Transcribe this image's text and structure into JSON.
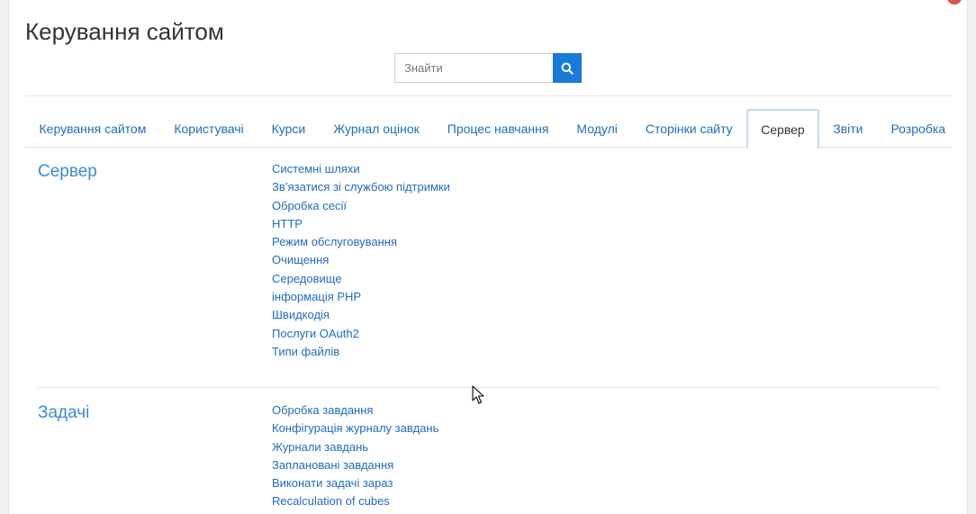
{
  "header": {
    "title": "Керування сайтом"
  },
  "search": {
    "placeholder": "Знайти",
    "icon": "search-icon",
    "button_color": "#1a7ad9"
  },
  "tabs": [
    {
      "label": "Керування сайтом",
      "active": false
    },
    {
      "label": "Користувачі",
      "active": false
    },
    {
      "label": "Курси",
      "active": false
    },
    {
      "label": "Журнал оцінок",
      "active": false
    },
    {
      "label": "Процес навчання",
      "active": false
    },
    {
      "label": "Модулі",
      "active": false
    },
    {
      "label": "Сторінки сайту",
      "active": false
    },
    {
      "label": "Сервер",
      "active": true
    },
    {
      "label": "Звіти",
      "active": false
    },
    {
      "label": "Розробка",
      "active": false
    }
  ],
  "sections": [
    {
      "title": "Сервер",
      "links": [
        "Системні шляхи",
        "Зв’язатися зі службою підтримки",
        "Обробка сесії",
        "HTTP",
        "Режим обслуговування",
        "Очищення",
        "Середовище",
        "інформація PHP",
        "Швидкодія",
        "Послуги OAuth2",
        "Типи файлів"
      ]
    },
    {
      "title": "Задачі",
      "links": [
        "Обробка завдання",
        "Конфігурація журналу завдань",
        "Журнали завдань",
        "Заплановані завдання",
        "Виконати задачі зараз",
        "Recalculation of cubes"
      ]
    }
  ],
  "colors": {
    "link": "#1f6cc0",
    "section_title": "#3a8ad8",
    "active_tab_border": "#c6dced"
  }
}
